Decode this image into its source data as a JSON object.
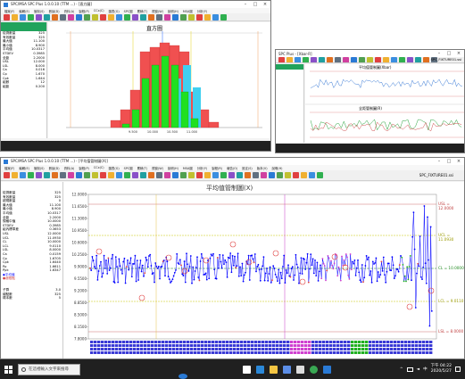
{
  "win_main": {
    "title": "SPC/MSA SPC Plus 1.0.0.10 (TTM ...) - [平均值管制圖(X)]",
    "menu": [
      "檔案(F)",
      "編輯(E)",
      "管制(S)",
      "數據(D)",
      "資料(A)",
      "製程(P)",
      "CCx(C)",
      "圖表(G)",
      "SPC圖",
      "累積(T)",
      "視窗(W)",
      "說明(H)",
      "MSA圖",
      "分析(Y)",
      "製程(R)",
      "報告(O)",
      "設定(S)",
      "版本(V)",
      "說明(H)"
    ],
    "toolbar_right": "SPC_FIXTURE01.ssi",
    "chart_title": "平均值管制圖(X)",
    "y_ticks": [
      "12.0000",
      "11.6500",
      "11.3000",
      "10.9500",
      "10.6000",
      "10.2500",
      "9.9000",
      "9.5500",
      "9.2000",
      "8.8500",
      "8.5000",
      "8.1500",
      "7.8000"
    ],
    "lines": {
      "usl": "USL = 12.0000",
      "ucl": "UCL = 11.0930",
      "cl": "CL = 10.0000",
      "lcl": "LCL = 9.0110",
      "lsl": "LSL = 8.0000"
    },
    "stats": [
      [
        "檢測數量",
        "325"
      ],
      [
        "有效數量",
        "325"
      ],
      [
        "超規數量",
        "0"
      ],
      [
        "最大值",
        "11.100"
      ],
      [
        "最小值",
        "8.900"
      ],
      [
        "平均值",
        "10.0317"
      ],
      [
        "全距",
        "2.2000"
      ],
      [
        "規格中值",
        "10.0000"
      ],
      [
        "STDEV",
        "0.3985"
      ],
      [
        "組內標準差",
        "0.3653"
      ],
      [
        "USL",
        "12.0000"
      ],
      [
        "UCL",
        "11.0930"
      ],
      [
        "CL",
        "10.0000"
      ],
      [
        "LCL",
        "9.0110"
      ],
      [
        "LSL",
        "8.0000"
      ],
      [
        "Ca",
        "0.0159"
      ],
      [
        "Cp",
        "1.6705"
      ],
      [
        "Cpk",
        "1.6440"
      ],
      [
        "Pp",
        "1.6611"
      ],
      [
        "Ppk",
        "1.6347"
      ]
    ],
    "legend": [
      "◆平均值",
      "●超限點"
    ],
    "extra": [
      [
        "子群",
        "3.0"
      ],
      [
        "總點數",
        "325"
      ],
      [
        "樣本數",
        "5"
      ]
    ],
    "colors": {
      "chart_bg": "#ffffff",
      "series": "#0000ff",
      "cl": "#228b22",
      "limit": "#d07070",
      "control": "#c8c800"
    }
  },
  "win_hist": {
    "title": "SPC/MSA SPC Plus 1.0.0.10 (TTM ...) - [直方圖]",
    "chart_title": "直方圖",
    "x_ticks": [
      "9.500",
      "10.000",
      "10.500",
      "11.000"
    ],
    "stats": [
      [
        "檢測數量",
        "325"
      ],
      [
        "有效數量",
        "325"
      ],
      [
        "最大值",
        "11.100"
      ],
      [
        "最小值",
        "8.900"
      ],
      [
        "平均值",
        "10.0317"
      ],
      [
        "STDEV",
        "0.3985"
      ],
      [
        "全距",
        "2.2000"
      ],
      [
        "USL",
        "12.000"
      ],
      [
        "LSL",
        "8.000"
      ],
      [
        "Ca",
        "0.016"
      ],
      [
        "Cp",
        "1.670"
      ],
      [
        "Cpk",
        "1.644"
      ],
      [
        "組數",
        "12"
      ],
      [
        "組距",
        "0.200"
      ]
    ]
  },
  "win_third": {
    "title": "SPC Plus - [Xbar-R]",
    "toolbar_right": "SPC_FIXTURE01.ssi",
    "chart1_title": "平均值管制圖(Xbar)",
    "chart2_title": "全距管制圖(R)"
  },
  "taskbar": {
    "search_placeholder": "在這裡輸入文字來搜尋",
    "time": "下午 04:22",
    "date": "2020/5/27",
    "lang": "中"
  }
}
